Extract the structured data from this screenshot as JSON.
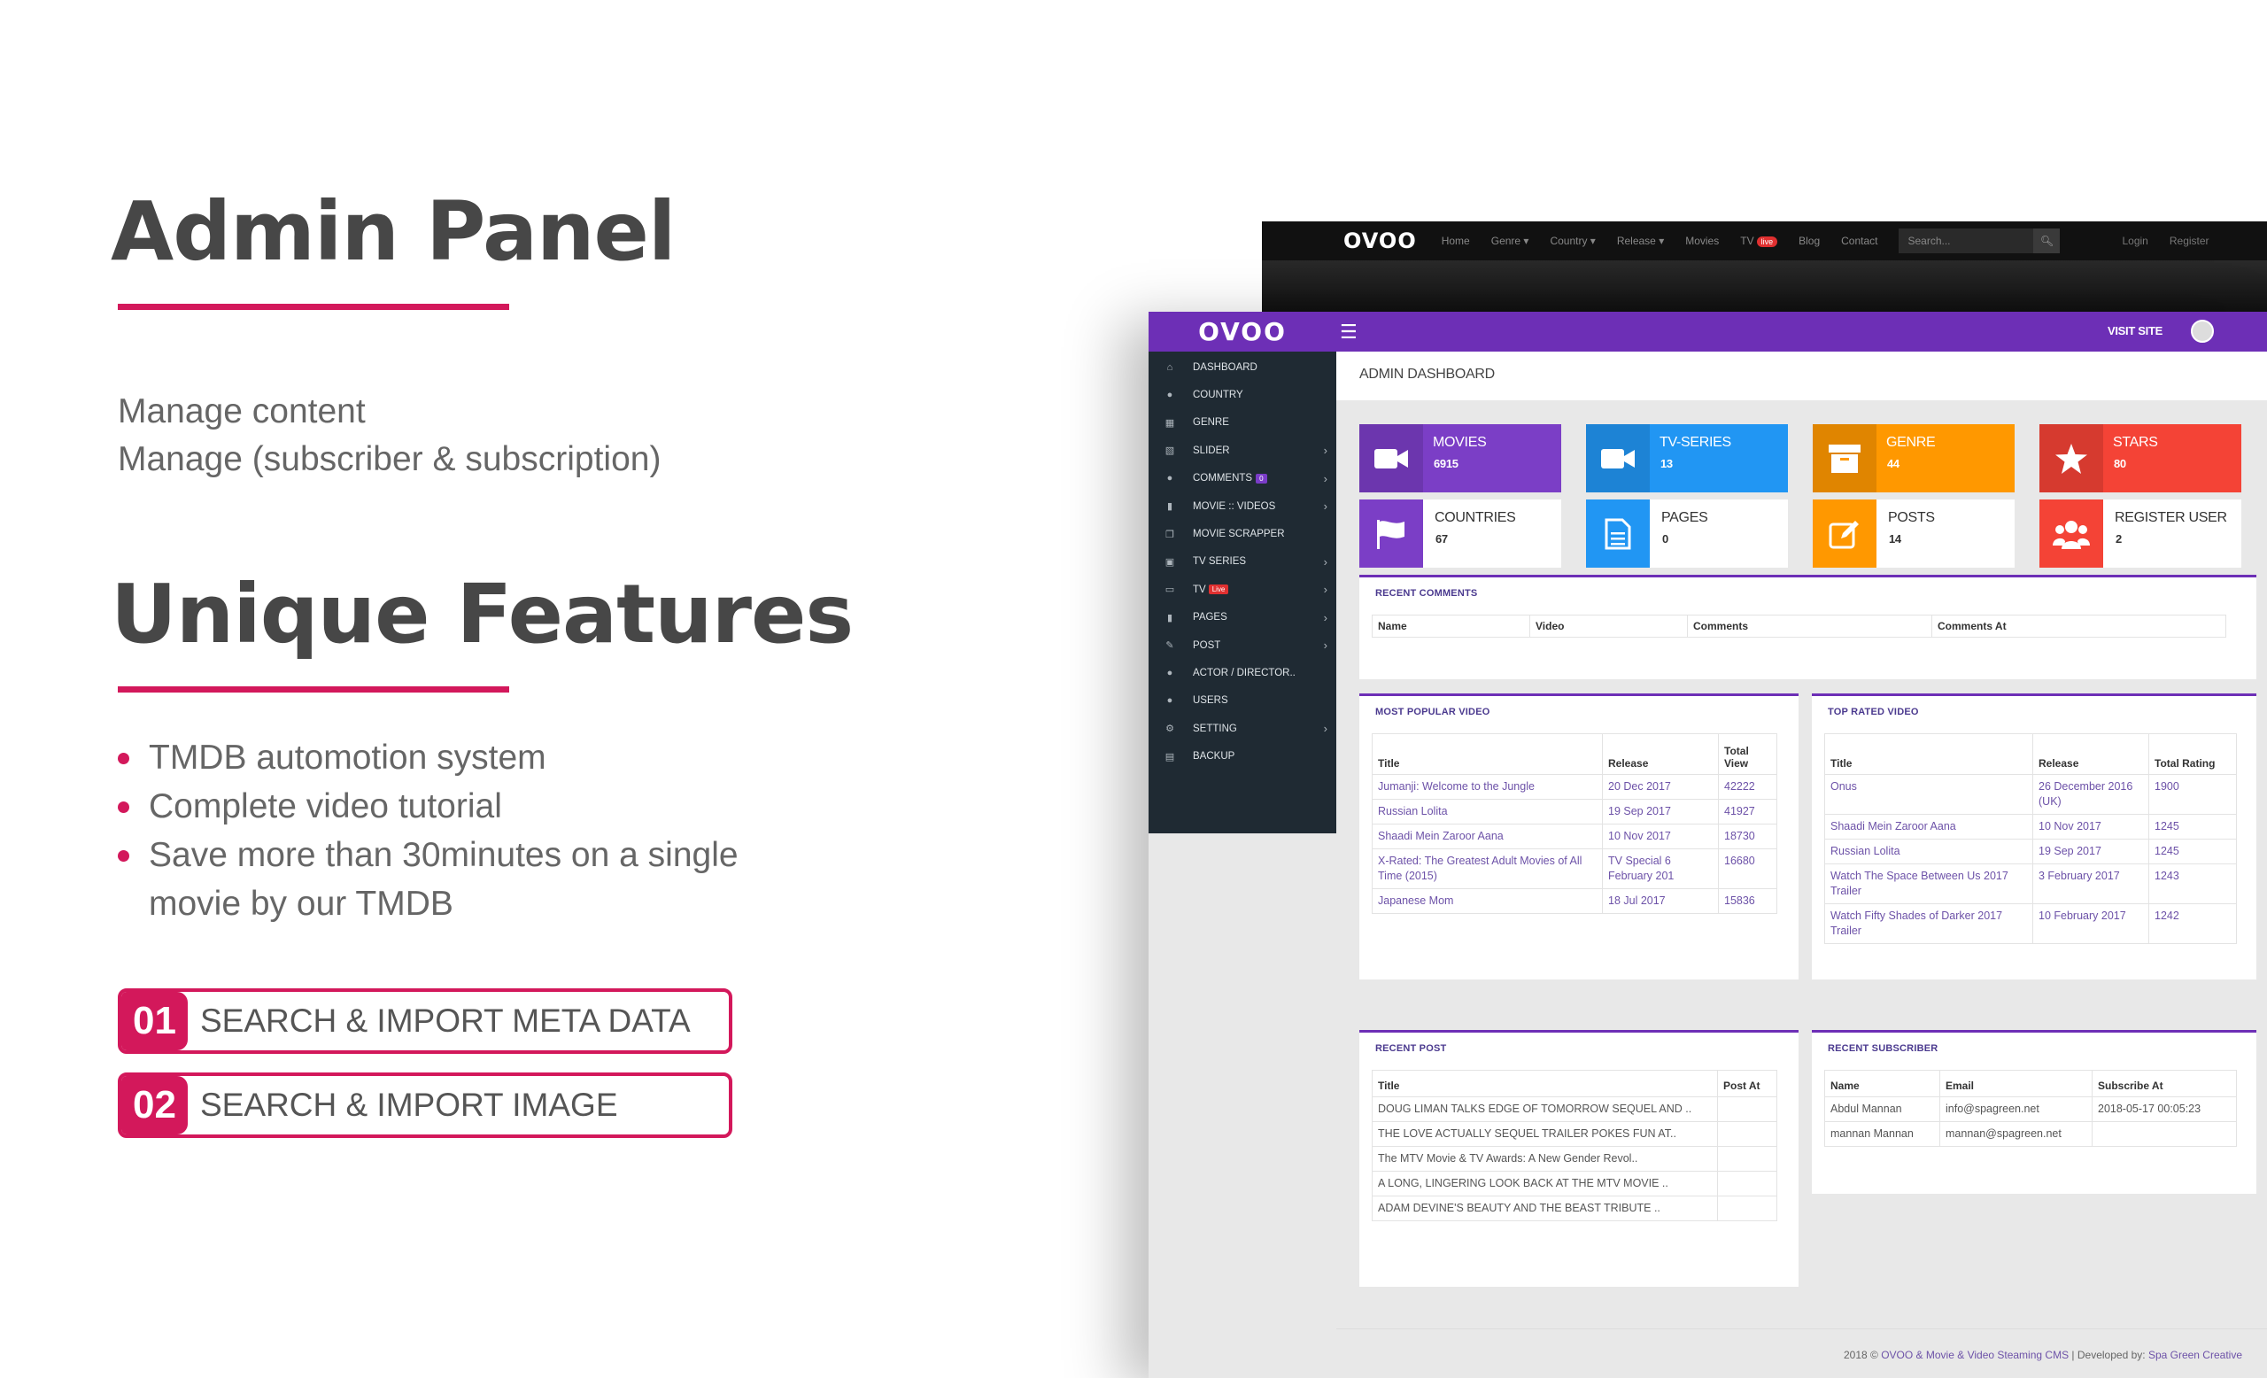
{
  "promo": {
    "title": "Admin Panel",
    "lead": [
      "Manage content",
      "Manage (subscriber & subscription)"
    ],
    "features_title": "Unique Features",
    "features": [
      "TMDB automotion system",
      "Complete video tutorial",
      "Save more than 30minutes on a single",
      "movie by our TMDB"
    ],
    "steps": [
      {
        "num": "01",
        "label": "SEARCH & IMPORT META DATA"
      },
      {
        "num": "02",
        "label": "SEARCH & IMPORT IMAGE"
      }
    ],
    "accent_color": "#d3185b"
  },
  "front": {
    "logo": "OVOO",
    "menu": [
      "Home",
      "Genre ▾",
      "Country ▾",
      "Release ▾",
      "Movies",
      "TV",
      "Blog",
      "Contact"
    ],
    "live_badge": "live",
    "search_placeholder": "Search...",
    "login": "Login",
    "register": "Register"
  },
  "admin": {
    "logo": "OVOO",
    "visit_site": "VISIT SITE",
    "brand_color": "#6d2fb6",
    "sidebar": [
      {
        "label": "DASHBOARD",
        "icon": "home-icon"
      },
      {
        "label": "COUNTRY",
        "icon": "globe-icon"
      },
      {
        "label": "GENRE",
        "icon": "list-icon"
      },
      {
        "label": "SLIDER",
        "icon": "slider-icon",
        "arrow": true
      },
      {
        "label": "COMMENTS",
        "icon": "comment-icon",
        "badge": "0",
        "arrow": true
      },
      {
        "label": "MOVIE :: VIDEOS",
        "icon": "video-icon",
        "arrow": true
      },
      {
        "label": "MOVIE SCRAPPER",
        "icon": "copy-icon"
      },
      {
        "label": "TV SERIES",
        "icon": "film-icon",
        "arrow": true
      },
      {
        "label": "TV",
        "icon": "tv-icon",
        "live": "Live",
        "arrow": true
      },
      {
        "label": "PAGES",
        "icon": "page-icon",
        "arrow": true
      },
      {
        "label": "POST",
        "icon": "edit-icon",
        "arrow": true
      },
      {
        "label": "ACTOR / DIRECTOR..",
        "icon": "users-icon"
      },
      {
        "label": "USERS",
        "icon": "user-icon"
      },
      {
        "label": "SETTING",
        "icon": "gears-icon",
        "arrow": true
      },
      {
        "label": "BACKUP",
        "icon": "database-icon"
      }
    ],
    "page_title": "ADMIN DASHBOARD",
    "cards": [
      {
        "label": "MOVIES",
        "value": "6915",
        "color": "#7b3ec6",
        "icon": "video-camera-icon",
        "style": "solid"
      },
      {
        "label": "TV-SERIES",
        "value": "13",
        "color": "#2196f3",
        "icon": "video-camera-icon",
        "style": "solid"
      },
      {
        "label": "GENRE",
        "value": "44",
        "color": "#ff9800",
        "icon": "archive-icon",
        "style": "solid"
      },
      {
        "label": "STARS",
        "value": "80",
        "color": "#f44336",
        "icon": "star-icon",
        "style": "solid"
      },
      {
        "label": "COUNTRIES",
        "value": "67",
        "color": "#7b3ec6",
        "icon": "flag-icon",
        "style": "light"
      },
      {
        "label": "PAGES",
        "value": "0",
        "color": "#2196f3",
        "icon": "file-icon",
        "style": "light"
      },
      {
        "label": "POSTS",
        "value": "14",
        "color": "#ff9800",
        "icon": "edit-icon",
        "style": "light"
      },
      {
        "label": "REGISTER USER",
        "value": "2",
        "color": "#f44336",
        "icon": "users-icon",
        "style": "light"
      }
    ],
    "recent_comments": {
      "title": "RECENT COMMENTS",
      "columns": [
        "Name",
        "Video",
        "Comments",
        "Comments At"
      ]
    },
    "popular": {
      "title": "MOST POPULAR VIDEO",
      "columns": [
        "Title",
        "Release",
        "Total View"
      ],
      "rows": [
        [
          "Jumanji: Welcome to the Jungle",
          "20 Dec 2017",
          "42222"
        ],
        [
          "Russian Lolita",
          "19 Sep 2017",
          "41927"
        ],
        [
          "Shaadi Mein Zaroor Aana",
          "10 Nov 2017",
          "18730"
        ],
        [
          "X-Rated: The Greatest Adult Movies of All Time (2015)",
          "TV Special 6 February 201",
          "16680"
        ],
        [
          "Japanese Mom",
          "18 Jul 2017",
          "15836"
        ]
      ]
    },
    "top_rated": {
      "title": "TOP RATED VIDEO",
      "columns": [
        "Title",
        "Release",
        "Total Rating"
      ],
      "rows": [
        [
          "Onus",
          "26 December 2016 (UK)",
          "1900"
        ],
        [
          "Shaadi Mein Zaroor Aana",
          "10 Nov 2017",
          "1245"
        ],
        [
          "Russian Lolita",
          "19 Sep 2017",
          "1245"
        ],
        [
          "Watch The Space Between Us 2017 Trailer",
          "3 February 2017",
          "1243"
        ],
        [
          "Watch Fifty Shades of Darker 2017 Trailer",
          "10 February 2017",
          "1242"
        ]
      ]
    },
    "recent_post": {
      "title": "RECENT POST",
      "columns": [
        "Title",
        "Post At"
      ],
      "rows": [
        [
          "DOUG LIMAN TALKS EDGE OF TOMORROW SEQUEL AND ..",
          ""
        ],
        [
          "THE LOVE ACTUALLY SEQUEL TRAILER POKES FUN AT..",
          ""
        ],
        [
          "The MTV Movie & TV Awards: A New Gender Revol..",
          ""
        ],
        [
          "A LONG, LINGERING LOOK BACK AT THE MTV MOVIE ..",
          ""
        ],
        [
          "ADAM DEVINE'S BEAUTY AND THE BEAST TRIBUTE ..",
          ""
        ]
      ]
    },
    "recent_subscriber": {
      "title": "RECENT SUBSCRIBER",
      "columns": [
        "Name",
        "Email",
        "Subscribe At"
      ],
      "rows": [
        [
          "Abdul Mannan",
          "info@spagreen.net",
          "2018-05-17 00:05:23"
        ],
        [
          "mannan Mannan",
          "mannan@spagreen.net",
          ""
        ]
      ]
    },
    "footer": {
      "prefix": "2018 ©",
      "product": "OVOO & Movie & Video Steaming CMS",
      "middle": "| Developed by:",
      "developer": "Spa Green Creative"
    }
  }
}
